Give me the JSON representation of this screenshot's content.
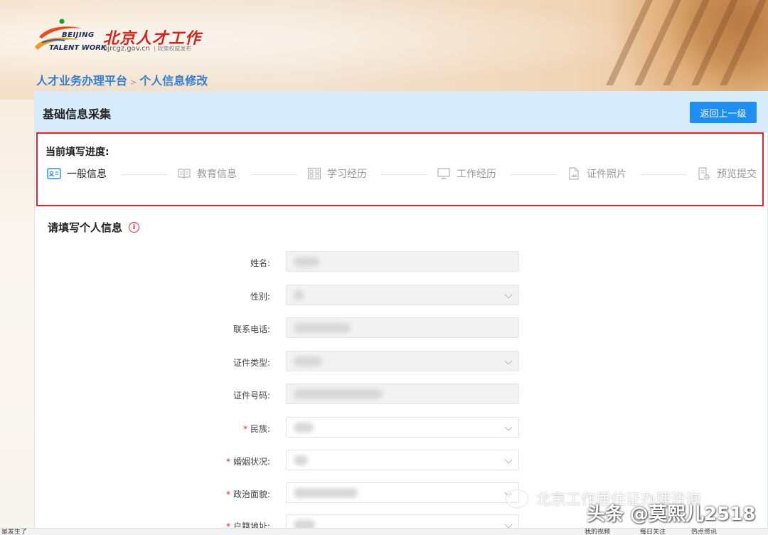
{
  "header": {
    "logo_en_line1": "BEIJING",
    "logo_en_line2": "TALENT WORK",
    "logo_cn": "北京人才工作",
    "domain": "bjrcgz.gov.cn",
    "slogan": "| 政策权威发布"
  },
  "breadcrumb": {
    "home": "人才业务办理平台",
    "separator": ">",
    "current": "个人信息修改"
  },
  "card": {
    "title": "基础信息采集",
    "back_button": "返回上一级"
  },
  "progress": {
    "label": "当前填写进度:",
    "steps": [
      {
        "label": "一般信息",
        "icon": "id-card-icon",
        "active": true
      },
      {
        "label": "教育信息",
        "icon": "book-icon",
        "active": false
      },
      {
        "label": "学习经历",
        "icon": "grid-icon",
        "active": false
      },
      {
        "label": "工作经历",
        "icon": "computer-icon",
        "active": false
      },
      {
        "label": "证件照片",
        "icon": "photo-doc-icon",
        "active": false
      },
      {
        "label": "预览提交",
        "icon": "preview-doc-icon",
        "active": false
      }
    ]
  },
  "form": {
    "section_title": "请填写个人信息",
    "fields": [
      {
        "label": "姓名:",
        "required": false,
        "type": "text"
      },
      {
        "label": "性别:",
        "required": false,
        "type": "select"
      },
      {
        "label": "联系电话:",
        "required": false,
        "type": "text"
      },
      {
        "label": "证件类型:",
        "required": false,
        "type": "select"
      },
      {
        "label": "证件号码:",
        "required": false,
        "type": "text"
      },
      {
        "label": "民族:",
        "required": true,
        "type": "select"
      },
      {
        "label": "婚姻状况:",
        "required": true,
        "type": "select"
      },
      {
        "label": "政治面貌:",
        "required": true,
        "type": "select"
      },
      {
        "label": "户籍地址:",
        "required": true,
        "type": "select"
      }
    ]
  },
  "watermark": {
    "line1": "北京工作居住证办理咨询",
    "line2": "头条 @莫熙儿2518"
  },
  "statusbar": {
    "left_text": "是发生了",
    "items": [
      "我的视频",
      "每日关注",
      "热点资讯"
    ]
  },
  "colors": {
    "accent_blue": "#1e8ef0",
    "highlight_red": "#e0262b",
    "breadcrumb_blue": "#2f7fd4"
  }
}
